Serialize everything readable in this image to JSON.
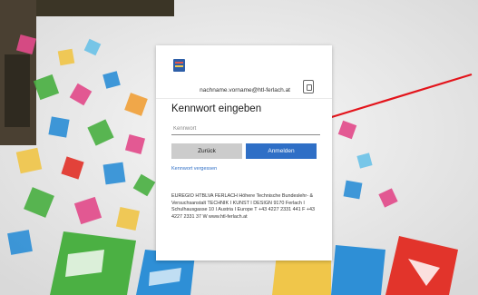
{
  "login": {
    "email": "nachname.vorname@htl-ferlach.at",
    "heading": "Kennwort eingeben",
    "password_placeholder": "Kennwort",
    "password_value": "",
    "back_label": "Zurück",
    "signin_label": "Anmelden",
    "forgot_label": "Kennwort vergessen",
    "footer_text": "EUREGIO HTBLVA FERLACH Höhere Technische Bundeslehr- & Versuchsanstalt TECHNIK I KUNST I DESIGN 9170 Ferlach I Schulhausgasse 10 I Austria I Europe T +43 4227 2331 441 F +43 4227 2331 37 W www.htl-ferlach.at"
  },
  "colors": {
    "accent": "#2f6fc6",
    "annotation_arrow": "#e3141b",
    "back_button": "#cccccc"
  },
  "icons": {
    "logo": "school-logo-icon",
    "account": "account-badge-icon"
  }
}
